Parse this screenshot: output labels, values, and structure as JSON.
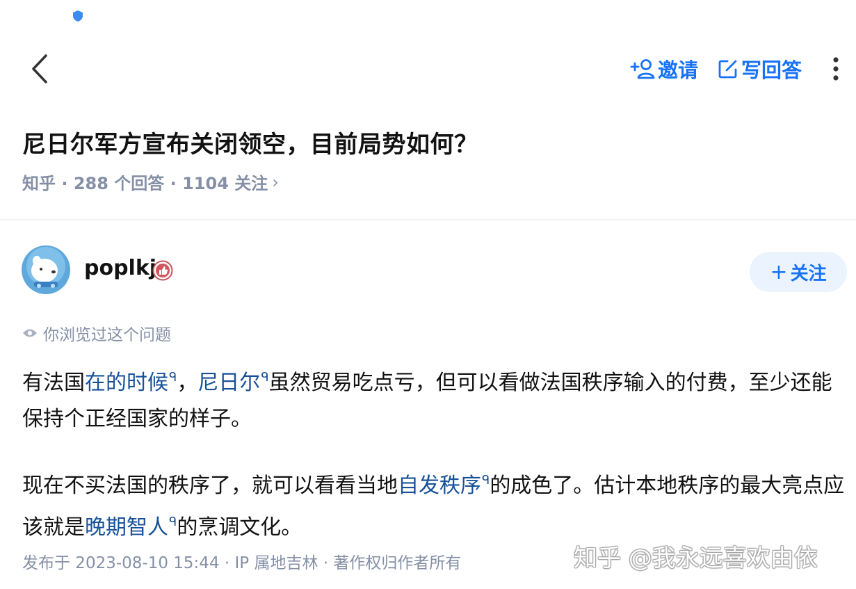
{
  "header": {
    "invite_label": "邀请",
    "write_answer_label": "写回答"
  },
  "question": {
    "title": "尼日尔军方宣布关闭领空，目前局势如何？",
    "meta": "知乎 · 288 个回答 · 1104 关注",
    "meta_chevron": "›"
  },
  "author": {
    "name": "poplkj",
    "follow_label": "关注",
    "follow_plus": "+"
  },
  "answer": {
    "viewed_note": "你浏览过这个问题",
    "p1_a": "有法国",
    "p1_link1": "在的时候",
    "p1_b": "，",
    "p1_link2": "尼日尔",
    "p1_c": "虽然贸易吃点亏，但可以看做法国秩序输入的付费，至少还能保持个正经国家的样子。",
    "p2_a": "现在不买法国的秩序了，就可以看看当地",
    "p2_link1": "自发秩序",
    "p2_b": "的成色了。估计本地秩序的最大亮点应该就是",
    "p2_link2": "晚期智人",
    "p2_c": "的烹调文化。",
    "search_glyph": "ᑫ",
    "publish_info": "发布于 2023-08-10 15:44 · IP 属地吉林 · 著作权归作者所有"
  },
  "watermark": "知乎 @我永远喜欢由依",
  "colors": {
    "brand_blue": "#1772f6",
    "link_blue": "#175199",
    "meta_gray": "#8590a6",
    "follow_bg": "#ebf3fe"
  }
}
